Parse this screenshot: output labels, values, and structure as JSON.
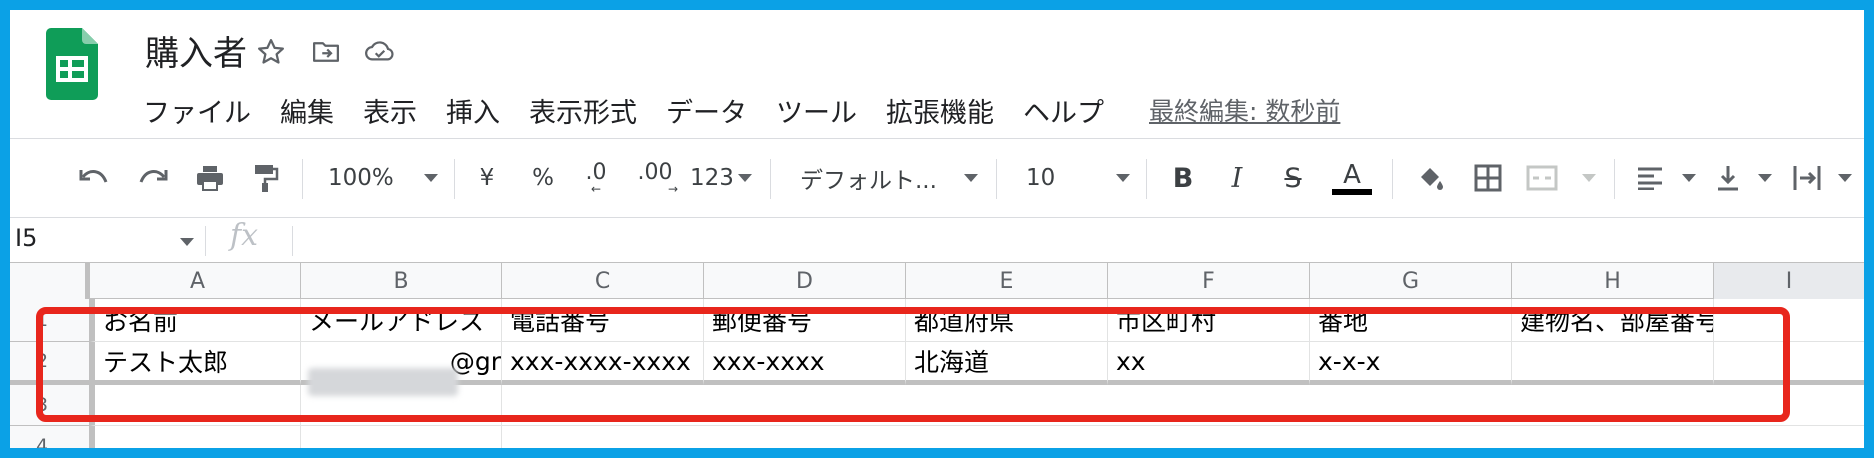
{
  "title": "購入者",
  "menu": [
    "ファイル",
    "編集",
    "表示",
    "挿入",
    "表示形式",
    "データ",
    "ツール",
    "拡張機能",
    "ヘルプ"
  ],
  "last_edit": "最終編集: 数秒前",
  "toolbar": {
    "zoom": "100%",
    "currency": "¥",
    "percent": "%",
    "decimal_decrease": ".0",
    "decimal_increase": ".00",
    "number_format": "123",
    "font": "デフォルト...",
    "font_size": "10",
    "bold": "B",
    "italic": "I",
    "strikethrough": "S",
    "text_color": "A",
    "text_color_value": "#000000"
  },
  "name_box": "I5",
  "formula_icon": "fx",
  "columns": [
    "A",
    "B",
    "C",
    "D",
    "E",
    "F",
    "G",
    "H",
    "I"
  ],
  "rows": [
    "1",
    "2",
    "3",
    "4"
  ],
  "cells": {
    "row1": [
      "お名前",
      "メールアドレス",
      "電話番号",
      "郵便番号",
      "都道府県",
      "市区町村",
      "番地",
      "建物名、部屋番号",
      ""
    ],
    "row2": [
      "テスト太郎",
      "@gr",
      "xxx-xxxx-xxxx",
      "xxx-xxxx",
      "北海道",
      "xx",
      "x-x-x",
      "",
      ""
    ]
  },
  "colors": {
    "background_border": "#0ba1e6",
    "highlight": "#e8261c",
    "sheets_green": "#0f9d58"
  }
}
